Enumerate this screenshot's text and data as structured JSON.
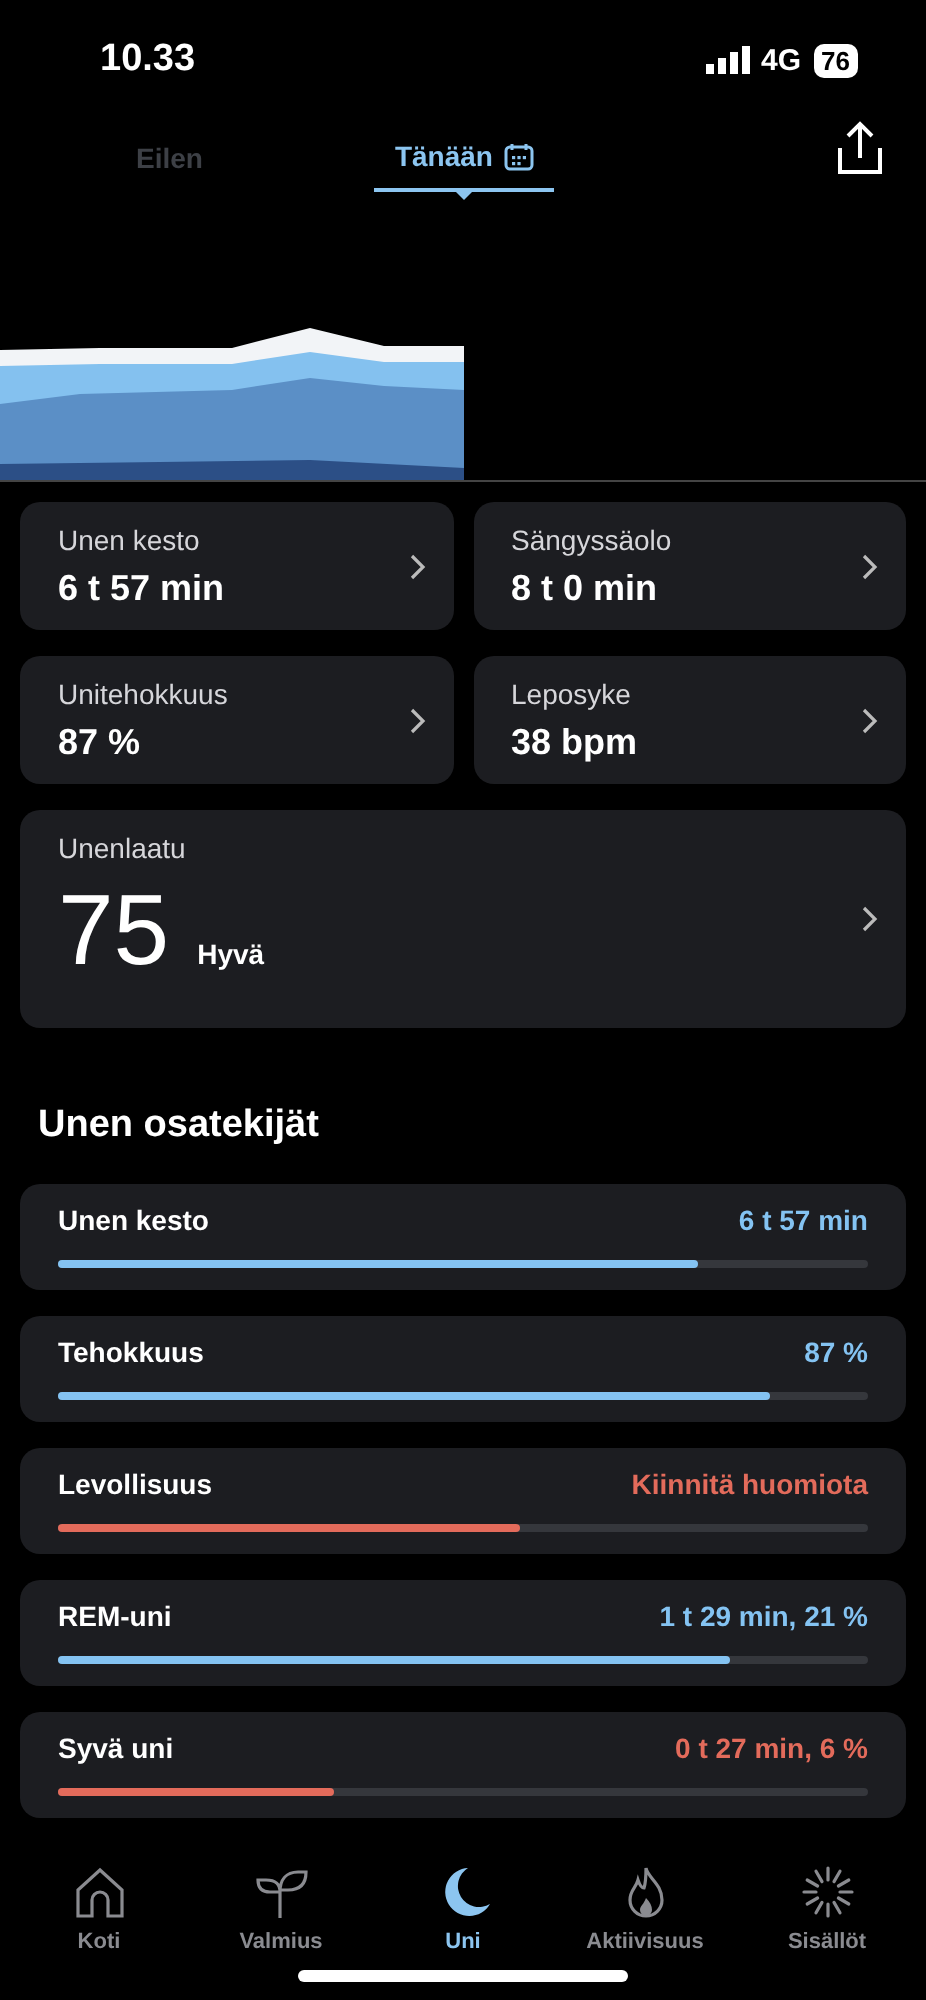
{
  "status_bar": {
    "time": "10.33",
    "network": "4G",
    "battery": "76"
  },
  "tabs": [
    {
      "label": "Eilen",
      "selected": false
    },
    {
      "label": "Tänään",
      "selected": true
    }
  ],
  "metrics": [
    {
      "label": "Unen kesto",
      "value": "6 t 57 min"
    },
    {
      "label": "Sängyssäolo",
      "value": "8 t 0 min"
    },
    {
      "label": "Unitehokkuus",
      "value": "87 %"
    },
    {
      "label": "Leposyke",
      "value": "38 bpm"
    }
  ],
  "sleep_quality": {
    "label": "Unenlaatu",
    "score": "75",
    "rating": "Hyvä"
  },
  "contributors_title": "Unen osatekijät",
  "contributors": [
    {
      "label": "Unen kesto",
      "value": "6 t 57 min",
      "level": 0.79,
      "color": "#84c3f2"
    },
    {
      "label": "Tehokkuus",
      "value": "87 %",
      "level": 0.88,
      "color": "#84c3f2"
    },
    {
      "label": "Levollisuus",
      "value": "Kiinnitä huomiota",
      "level": 0.57,
      "color": "#e36b5b"
    },
    {
      "label": "REM-uni",
      "value": "1 t 29 min, 21 %",
      "level": 0.83,
      "color": "#84c3f2"
    },
    {
      "label": "Syvä uni",
      "value": "0 t 27 min, 6 %",
      "level": 0.34,
      "color": "#e36b5b"
    }
  ],
  "nav": [
    {
      "label": "Koti",
      "kind": "home",
      "selected": false
    },
    {
      "label": "Valmius",
      "kind": "sprout",
      "selected": false
    },
    {
      "label": "Uni",
      "kind": "moon",
      "selected": true
    },
    {
      "label": "Aktiivisuus",
      "kind": "flame",
      "selected": false
    },
    {
      "label": "Sisällöt",
      "kind": "burst",
      "selected": false
    }
  ]
}
